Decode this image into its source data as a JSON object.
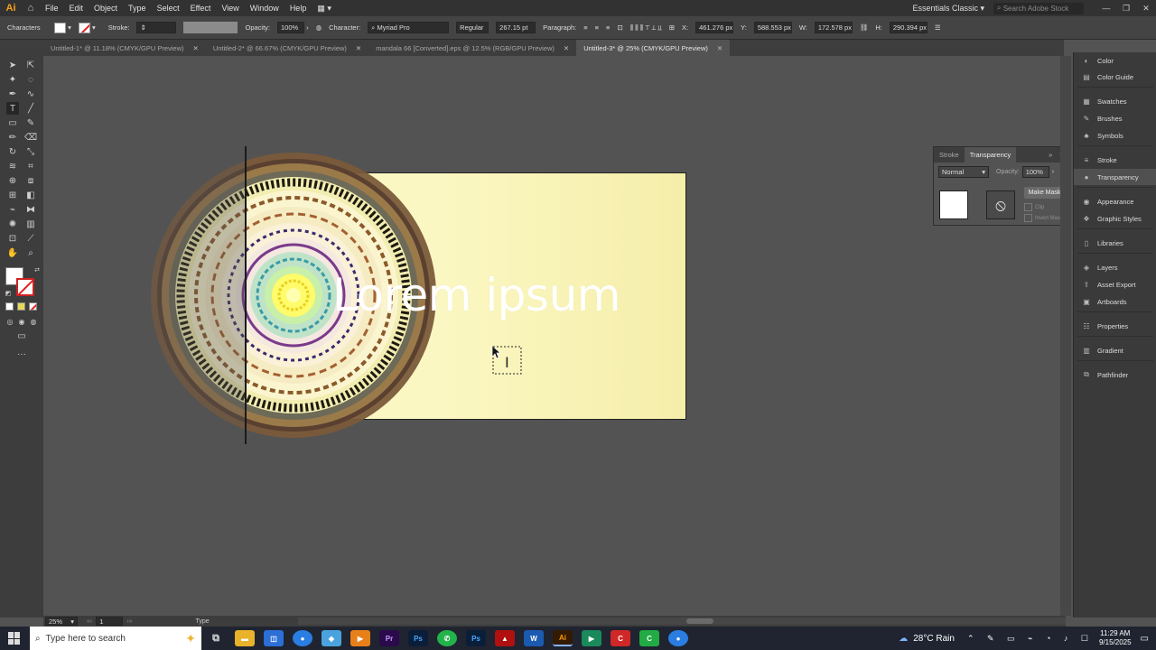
{
  "app": {
    "logo": "Ai",
    "menu": [
      "File",
      "Edit",
      "Object",
      "Type",
      "Select",
      "Effect",
      "View",
      "Window",
      "Help"
    ],
    "workspace": "Essentials Classic",
    "search_placeholder": "Search Adobe Stock"
  },
  "control_bar": {
    "section": "Characters",
    "stroke_label": "Stroke:",
    "opacity_label": "Opacity:",
    "opacity_value": "100%",
    "character_label": "Character:",
    "font": "Myriad Pro",
    "style": "Regular",
    "size": "267.15 pt",
    "paragraph_label": "Paragraph:",
    "x_label": "X:",
    "x_value": "461.276 px",
    "y_label": "Y:",
    "y_value": "588.553 px",
    "w_label": "W:",
    "w_value": "172.578 px",
    "h_label": "H:",
    "h_value": "290.394 px"
  },
  "tabs": [
    {
      "label": "Untitled-1* @ 11.18% (CMYK/GPU Preview)"
    },
    {
      "label": "Untitled-2* @ 66.67% (CMYK/GPU Preview)"
    },
    {
      "label": "mandala 66 [Converted].eps @ 12.5% (RGB/GPU Preview)"
    },
    {
      "label": "Untitled-3* @ 25% (CMYK/GPU Preview)"
    }
  ],
  "canvas": {
    "text": "Lorem ipsum"
  },
  "transparency_panel": {
    "tab_stroke": "Stroke",
    "tab_transparency": "Transparency",
    "blend_mode": "Normal",
    "opacity_label": "Opacity:",
    "opacity_value": "100%",
    "make_mask": "Make Mask",
    "clip": "Clip",
    "invert_mask": "Invert Mask"
  },
  "dock": {
    "items": [
      {
        "label": "Color",
        "icon": "color-icon"
      },
      {
        "label": "Color Guide",
        "icon": "color-guide-icon"
      },
      {
        "label": "Swatches",
        "icon": "swatches-icon"
      },
      {
        "label": "Brushes",
        "icon": "brushes-icon"
      },
      {
        "label": "Symbols",
        "icon": "symbols-icon"
      },
      {
        "label": "Stroke",
        "icon": "stroke-icon"
      },
      {
        "label": "Transparency",
        "icon": "transparency-icon"
      },
      {
        "label": "Appearance",
        "icon": "appearance-icon"
      },
      {
        "label": "Graphic Styles",
        "icon": "graphic-styles-icon"
      },
      {
        "label": "Libraries",
        "icon": "libraries-icon"
      },
      {
        "label": "Layers",
        "icon": "layers-icon"
      },
      {
        "label": "Asset Export",
        "icon": "asset-export-icon"
      },
      {
        "label": "Artboards",
        "icon": "artboards-icon"
      },
      {
        "label": "Properties",
        "icon": "properties-icon"
      },
      {
        "label": "Gradient",
        "icon": "gradient-icon"
      },
      {
        "label": "Pathfinder",
        "icon": "pathfinder-icon"
      }
    ]
  },
  "status": {
    "zoom": "25%",
    "artboard_num": "1",
    "tool": "Type"
  },
  "taskbar": {
    "search_placeholder": "Type here to search",
    "weather": "28°C Rain",
    "time": "11:29 AM",
    "date": "9/15/2025"
  }
}
